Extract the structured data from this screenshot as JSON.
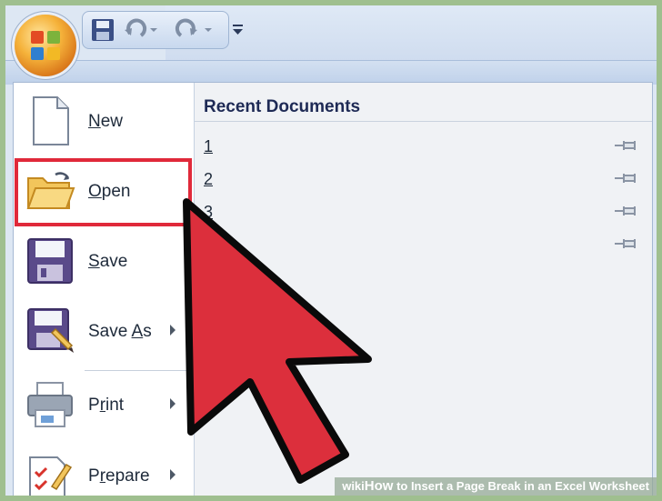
{
  "colors": {
    "highlight": "#e0293a",
    "cursor": "#dc2f3c",
    "menu_bg": "#ffffff"
  },
  "quick_access": {
    "icons": [
      "save-icon",
      "undo-icon",
      "redo-icon",
      "customize-icon"
    ]
  },
  "office_button": {
    "icon": "office-logo-icon"
  },
  "menu": {
    "items": [
      {
        "label": "New",
        "icon": "new-document-icon",
        "has_submenu": false
      },
      {
        "label": "Open",
        "icon": "open-folder-icon",
        "has_submenu": false
      },
      {
        "label": "Save",
        "icon": "save-disk-icon",
        "has_submenu": false
      },
      {
        "label": "Save As",
        "icon": "save-as-icon",
        "has_submenu": true
      },
      {
        "label": "Print",
        "icon": "printer-icon",
        "has_submenu": true
      },
      {
        "label": "Prepare",
        "icon": "prepare-icon",
        "has_submenu": true
      }
    ]
  },
  "recent": {
    "title": "Recent Documents",
    "documents": [
      {
        "number": "1"
      },
      {
        "number": "2"
      },
      {
        "number": "3"
      },
      {
        "number": ""
      }
    ]
  },
  "banner": {
    "wiki": "wiki",
    "how": "How",
    "text": " to Insert a Page Break in an Excel Worksheet"
  }
}
